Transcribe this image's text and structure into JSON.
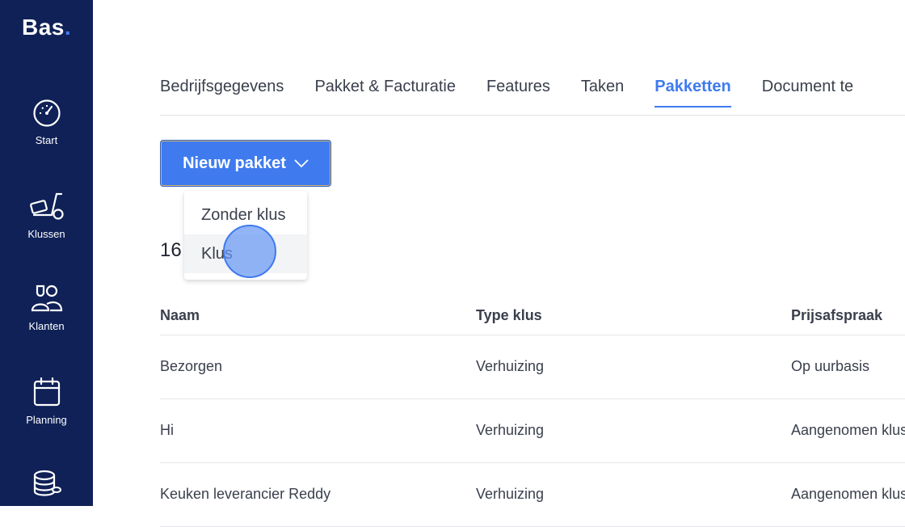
{
  "sidebar": {
    "logo_text": "Bas",
    "logo_dot": ".",
    "items": [
      {
        "label": "Start",
        "icon": "dashboard-gauge-icon"
      },
      {
        "label": "Klussen",
        "icon": "moving-dolly-icon"
      },
      {
        "label": "Klanten",
        "icon": "customers-icon"
      },
      {
        "label": "Planning",
        "icon": "calendar-icon"
      },
      {
        "label": "",
        "icon": "database-coins-icon"
      }
    ]
  },
  "tabs": [
    {
      "label": "Bedrijfsgegevens",
      "active": false
    },
    {
      "label": "Pakket & Facturatie",
      "active": false
    },
    {
      "label": "Features",
      "active": false
    },
    {
      "label": "Taken",
      "active": false
    },
    {
      "label": "Pakketten",
      "active": true
    },
    {
      "label": "Document te",
      "active": false
    }
  ],
  "new_button": {
    "label": "Nieuw pakket"
  },
  "dropdown": {
    "items": [
      "Zonder klus",
      "Klus"
    ]
  },
  "count": "16",
  "table": {
    "headers": [
      "Naam",
      "Type klus",
      "Prijsafspraak"
    ],
    "rows": [
      [
        "Bezorgen",
        "Verhuizing",
        "Op uurbasis"
      ],
      [
        "Hi",
        "Verhuizing",
        "Aangenomen klus"
      ],
      [
        "Keuken leverancier Reddy",
        "Verhuizing",
        "Aangenomen klus"
      ]
    ]
  },
  "colors": {
    "sidebar": "#0f2157",
    "accent": "#3f7bef"
  }
}
